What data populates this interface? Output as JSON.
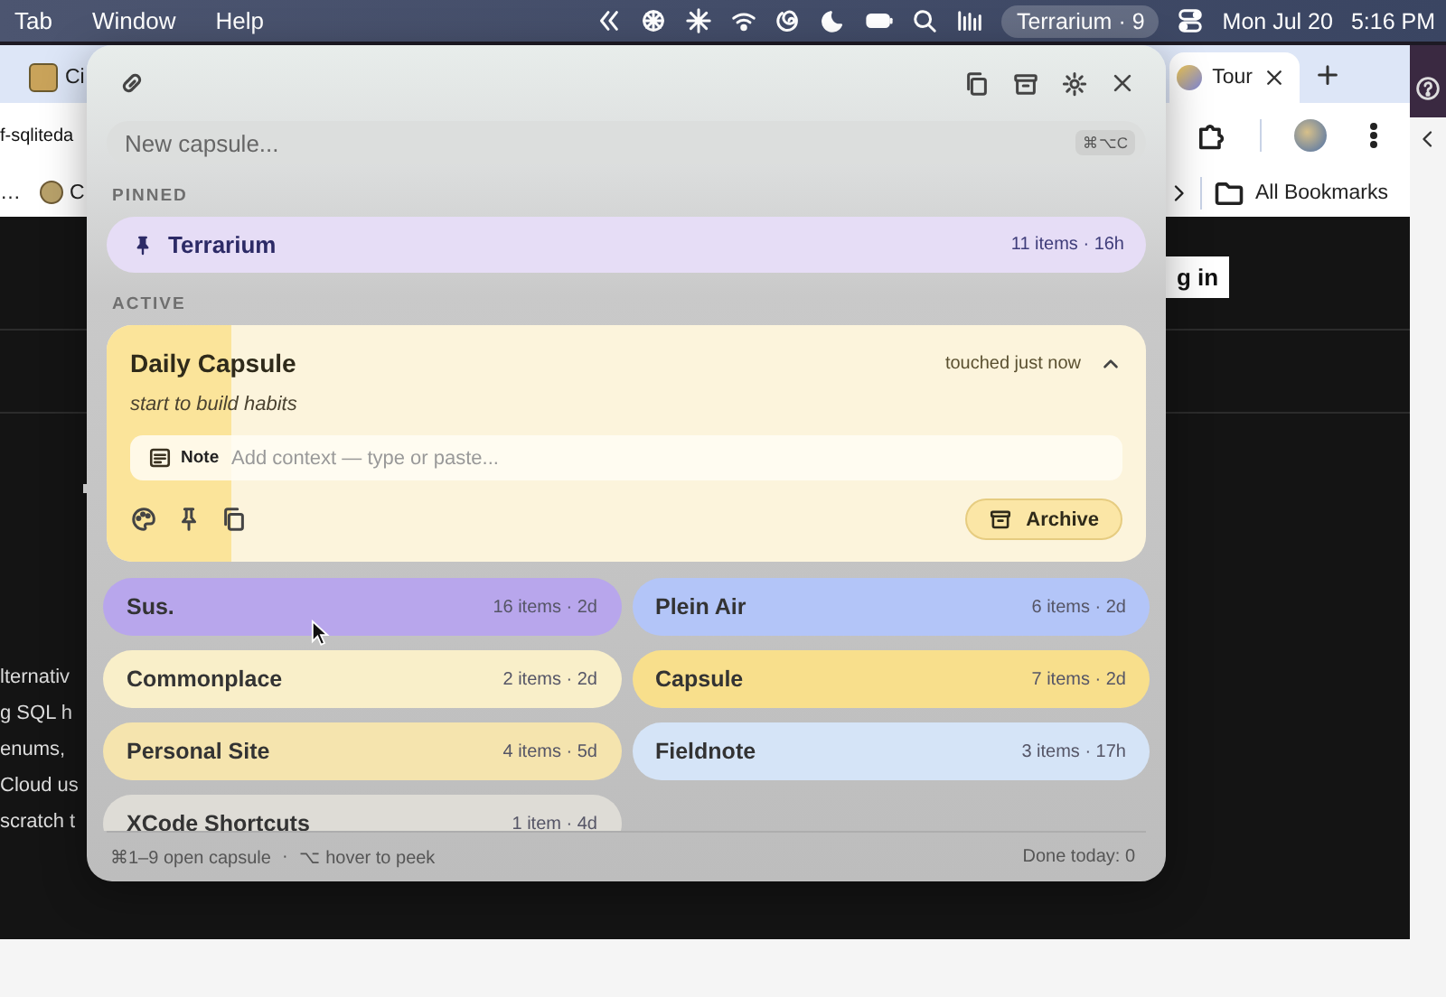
{
  "menubar": {
    "menus": [
      "Tab",
      "Window",
      "Help"
    ],
    "status_pill": "Terrarium · 9",
    "date": "Mon Jul 20",
    "time": "5:16 PM"
  },
  "browser": {
    "tabs": [
      {
        "label": "Ci",
        "selected": false
      },
      {
        "label": "Tour",
        "selected": true
      }
    ],
    "address": "f-sqliteda",
    "bookmarks": [
      "…",
      "C"
    ],
    "all_bookmarks": "All Bookmarks",
    "page_button": "g in",
    "page_text": [
      "lternativ",
      "g SQL h",
      "enums,",
      "Cloud us",
      "scratch t"
    ]
  },
  "popover": {
    "search": {
      "placeholder": "New capsule...",
      "shortcut": "⌘⌥C"
    },
    "pinned_label": "PINNED",
    "pinned": [
      {
        "name": "Terrarium",
        "meta": "11 items · 16h",
        "color": "#e6ddf6"
      }
    ],
    "active_label": "ACTIVE",
    "expanded": {
      "name": "Daily Capsule",
      "touched": "touched just now",
      "expanded": true,
      "subtitle": "start to build habits",
      "note_label": "Note",
      "note_placeholder": "Add context — type or paste...",
      "archive": "Archive",
      "color": "#fcf4dc",
      "level": 0.12
    },
    "capsules": [
      {
        "name": "Sus.",
        "meta": "16 items · 2d",
        "color": "#b8a6ec"
      },
      {
        "name": "Plein Air",
        "meta": "6 items · 2d",
        "color": "#b3c5f8"
      },
      {
        "name": "Commonplace",
        "meta": "2 items · 2d",
        "color": "#f9efc9"
      },
      {
        "name": "Capsule",
        "meta": "7 items · 2d",
        "color": "#f8df8c"
      },
      {
        "name": "Personal Site",
        "meta": "4 items · 5d",
        "color": "#f5e4ae"
      },
      {
        "name": "Fieldnote",
        "meta": "3 items · 17h",
        "color": "#d5e4f7"
      },
      {
        "name": "XCode Shortcuts",
        "meta": "1 item · 4d",
        "color": "#dedcd6"
      }
    ],
    "footer": {
      "hints": [
        "⌘1–9 open capsule",
        "⌥ hover to peek"
      ],
      "separator": "·",
      "done": "Done today: 0"
    }
  }
}
